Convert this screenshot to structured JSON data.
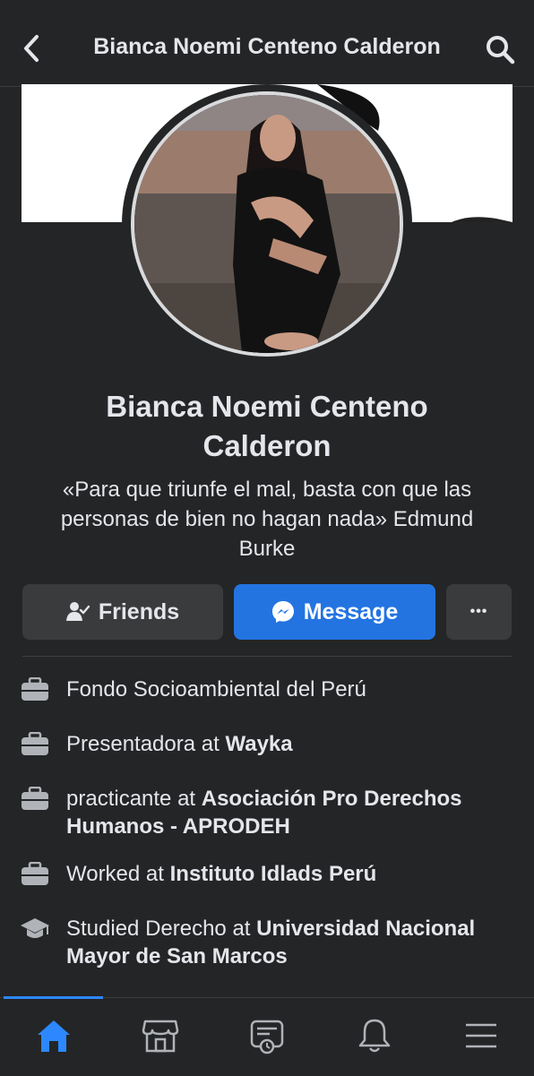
{
  "header": {
    "back_icon": "chevron-left-icon",
    "title": "Bianca Noemi Centeno Calderon",
    "search_icon": "search-icon"
  },
  "profile": {
    "name_line1": "Bianca Noemi Centeno",
    "name_line2": "Calderon",
    "bio_line1": "«Para que triunfe el mal, basta con que las",
    "bio_line2": "personas de bien no hagan nada» Edmund",
    "bio_line3": "Burke"
  },
  "actions": {
    "friends_label": "Friends",
    "message_label": "Message",
    "more_label": "•••"
  },
  "details": [
    {
      "icon": "briefcase-icon",
      "prefix": "",
      "bold": "",
      "plain_line": "Fondo Socioambiental del Perú"
    },
    {
      "icon": "briefcase-icon",
      "prefix": "Presentadora at ",
      "bold": "Wayka"
    },
    {
      "icon": "briefcase-icon",
      "prefix": "practicante at ",
      "bold": "Asociación Pro Derechos",
      "bold2": "Humanos - APRODEH"
    },
    {
      "icon": "briefcase-icon",
      "prefix": "Worked at ",
      "bold": "Instituto Idlads Perú"
    },
    {
      "icon": "graduation-cap-icon",
      "prefix": "Studied Derecho at ",
      "bold": "Universidad Nacional",
      "bold2": "Mayor de San Marcos"
    }
  ],
  "bottom_nav": [
    "home-icon",
    "marketplace-icon",
    "news-feed-icon",
    "notifications-icon",
    "menu-icon"
  ],
  "colors": {
    "background": "#242526",
    "accent": "#2374e1",
    "button_secondary": "#3a3b3c"
  }
}
